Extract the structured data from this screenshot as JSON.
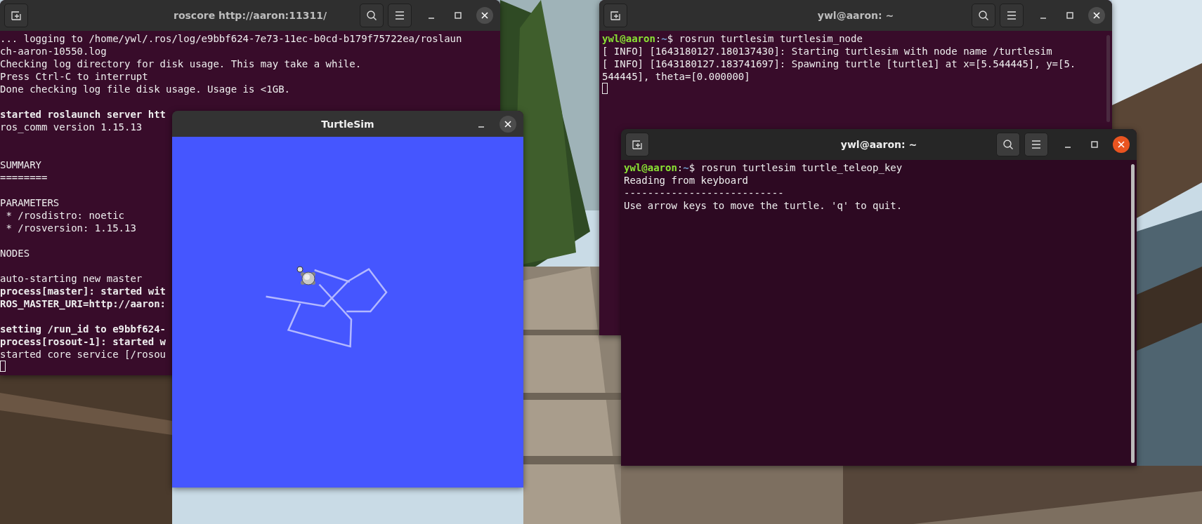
{
  "windows": [
    {
      "kind": "terminal",
      "title": "roscore http://aaron:11311/",
      "focused": false,
      "cursor": true,
      "lines": [
        {
          "kind": "output",
          "bold": false,
          "text": "... logging to /home/ywl/.ros/log/e9bbf624-7e73-11ec-b0cd-b179f75722ea/roslaun"
        },
        {
          "kind": "output",
          "bold": false,
          "text": "ch-aaron-10550.log"
        },
        {
          "kind": "output",
          "bold": false,
          "text": "Checking log directory for disk usage. This may take a while."
        },
        {
          "kind": "output",
          "bold": false,
          "text": "Press Ctrl-C to interrupt"
        },
        {
          "kind": "output",
          "bold": false,
          "text": "Done checking log file disk usage. Usage is <1GB."
        },
        {
          "kind": "blank"
        },
        {
          "kind": "output",
          "bold": true,
          "text": "started roslaunch server htt"
        },
        {
          "kind": "output",
          "bold": false,
          "text": "ros_comm version 1.15.13"
        },
        {
          "kind": "blank"
        },
        {
          "kind": "blank"
        },
        {
          "kind": "output",
          "bold": false,
          "text": "SUMMARY"
        },
        {
          "kind": "output",
          "bold": false,
          "text": "========"
        },
        {
          "kind": "blank"
        },
        {
          "kind": "output",
          "bold": false,
          "text": "PARAMETERS"
        },
        {
          "kind": "output",
          "bold": false,
          "text": " * /rosdistro: noetic"
        },
        {
          "kind": "output",
          "bold": false,
          "text": " * /rosversion: 1.15.13"
        },
        {
          "kind": "blank"
        },
        {
          "kind": "output",
          "bold": false,
          "text": "NODES"
        },
        {
          "kind": "blank"
        },
        {
          "kind": "output",
          "bold": false,
          "text": "auto-starting new master"
        },
        {
          "kind": "output",
          "bold": true,
          "text": "process[master]: started wit"
        },
        {
          "kind": "output",
          "bold": true,
          "text": "ROS_MASTER_URI=http://aaron:"
        },
        {
          "kind": "blank"
        },
        {
          "kind": "output",
          "bold": true,
          "text": "setting /run_id to e9bbf624-"
        },
        {
          "kind": "output",
          "bold": true,
          "text": "process[rosout-1]: started w"
        },
        {
          "kind": "output",
          "bold": false,
          "text": "started core service [/rosou"
        }
      ]
    },
    {
      "kind": "terminal",
      "title": "ywl@aaron: ~",
      "focused": false,
      "scrollbar": true,
      "cursor": true,
      "lines": [
        {
          "kind": "prompt",
          "user_host": "ywl@aaron",
          "separator": ":",
          "path": "~",
          "command": "$ rosrun turtlesim turtlesim_node"
        },
        {
          "kind": "output",
          "bold": false,
          "text": "[ INFO] [1643180127.180137430]: Starting turtlesim with node name /turtlesim"
        },
        {
          "kind": "output",
          "bold": false,
          "text": "[ INFO] [1643180127.183741697]: Spawning turtle [turtle1] at x=[5.544445], y=[5."
        },
        {
          "kind": "output",
          "bold": false,
          "text": "544445], theta=[0.000000]"
        }
      ]
    },
    {
      "kind": "turtlesim",
      "title": "TurtleSim",
      "focused": false
    },
    {
      "kind": "terminal",
      "title": "ywl@aaron: ~",
      "focused": true,
      "scrollbar": true,
      "lines": [
        {
          "kind": "prompt",
          "user_host": "ywl@aaron",
          "separator": ":",
          "path": "~",
          "command": "$ rosrun turtlesim turtle_teleop_key"
        },
        {
          "kind": "output",
          "bold": false,
          "text": "Reading from keyboard"
        },
        {
          "kind": "output",
          "bold": false,
          "text": "---------------------------"
        },
        {
          "kind": "output",
          "bold": false,
          "text": "Use arrow keys to move the turtle. 'q' to quit."
        }
      ]
    }
  ]
}
